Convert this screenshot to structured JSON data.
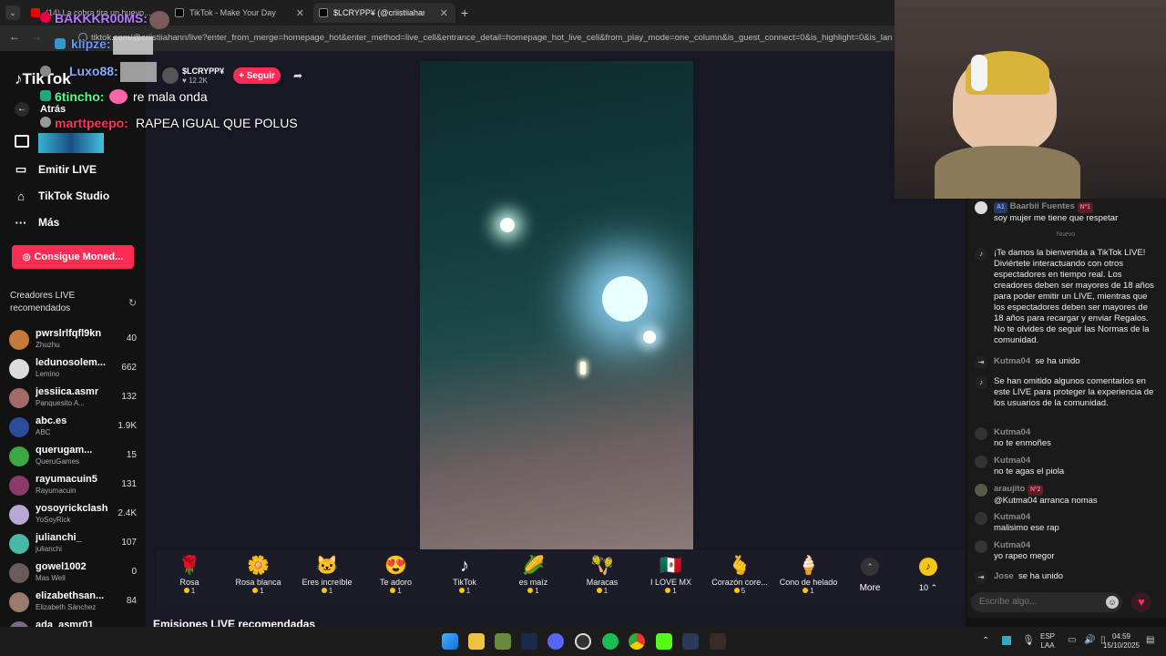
{
  "browser": {
    "tabs": [
      {
        "label": "(14) La cobra tira un huevo..."
      },
      {
        "label": "TikTok - Make Your Day"
      },
      {
        "label": "$LCRYPP¥ (@criistiiahann) ..."
      }
    ],
    "new_tab": "+",
    "url": "tiktok.com/@criistiiahann/live?enter_from_merge=homepage_hot&enter_method=live_cell&entrance_detail=homepage_hot_live_cell&from_play_mode=one_column&is_guest_connect=0&is_highlight=0&is_landsc"
  },
  "overlay_chat": [
    {
      "user": "BAKKKR00MS:",
      "text": ""
    },
    {
      "user": "klipze:",
      "text": ""
    },
    {
      "user": "Luxo88:",
      "text": ""
    },
    {
      "user": "6tincho:",
      "text": "re mala onda"
    },
    {
      "user": "marttpeepo:",
      "text": "RAPEA IGUAL QUE POLUS"
    }
  ],
  "sidebar": {
    "logo": "TikTok",
    "back": "Atrás",
    "items": [
      {
        "label": "Emitir LIVE",
        "icon": "camera-icon"
      },
      {
        "label": "TikTok Studio",
        "icon": "home-icon"
      },
      {
        "label": "Más",
        "icon": "more-icon"
      }
    ],
    "coins_button": "Consigue Moned...",
    "rec_title": "Creadores LIVE recomendados",
    "creators": [
      {
        "name": "pwrslrlfqfl9kn",
        "sub": "Zhuzhu",
        "count": "40",
        "color": "#c47a3a"
      },
      {
        "name": "ledunosolem...",
        "sub": "Lemino",
        "count": "662",
        "color": "#dcdcdc"
      },
      {
        "name": "jessiica.asmr",
        "sub": "Panquesito A...",
        "count": "132",
        "color": "#a46a6a"
      },
      {
        "name": "abc.es",
        "sub": "ABC",
        "count": "1.9K",
        "color": "#2a4c9a"
      },
      {
        "name": "querugam...",
        "sub": "QueruGames",
        "count": "15",
        "color": "#3aa845"
      },
      {
        "name": "rayumacuin5",
        "sub": "Rayumacuin",
        "count": "131",
        "color": "#8a3a6a"
      },
      {
        "name": "yosoyrickclash",
        "sub": "YoSoyRick",
        "count": "2.4K",
        "color": "#b8a8d8"
      },
      {
        "name": "julianchi_",
        "sub": "julianchi",
        "count": "107",
        "color": "#4ab8a8"
      },
      {
        "name": "gowel1002",
        "sub": "Mas Well",
        "count": "0",
        "color": "#6a5a5a"
      },
      {
        "name": "elizabethsan...",
        "sub": "Elizabeth Sánchez",
        "count": "84",
        "color": "#9a7a6a"
      },
      {
        "name": "ada_asmr01",
        "sub": "",
        "count": "",
        "color": "#7a6a8a"
      }
    ]
  },
  "host": {
    "name": "$LCRYPP¥",
    "likes": "12.2K",
    "follow": "+ Seguir"
  },
  "gifts": [
    {
      "name": "Rosa",
      "cost": "1",
      "icon": "🌹"
    },
    {
      "name": "Rosa blanca",
      "cost": "1",
      "icon": "🌼"
    },
    {
      "name": "Eres increíble",
      "cost": "1",
      "icon": "🐱"
    },
    {
      "name": "Te adoro",
      "cost": "1",
      "icon": "😍"
    },
    {
      "name": "TikTok",
      "cost": "1",
      "icon": "♪"
    },
    {
      "name": "es maíz",
      "cost": "1",
      "icon": "🌽"
    },
    {
      "name": "Maracas",
      "cost": "1",
      "icon": "🪇"
    },
    {
      "name": "I LOVE MX",
      "cost": "1",
      "icon": "🇲🇽"
    },
    {
      "name": "Corazón core...",
      "cost": "5",
      "icon": "🫰"
    },
    {
      "name": "Cono de helado",
      "cost": "1",
      "icon": "🍦"
    }
  ],
  "gifts_more": "More",
  "coin_balance": "10",
  "section_heading": "Emisiones LIVE recomendadas",
  "chat": {
    "messages": [
      {
        "user": "Baarbii Fuentes",
        "badge": "Nº1",
        "text": "soy mujer me tiene que respetar"
      },
      {
        "divider": "Nuevo"
      },
      {
        "system": "¡Te damos la bienvenida a TikTok LIVE! Diviértete interactuando con otros espectadores en tiempo real. Los creadores deben ser mayores de 18 años para poder emitir un LIVE, mientras que los espectadores deben ser mayores de 18 años para recargar y enviar Regalos. No te olvides de seguir las Normas de la comunidad."
      },
      {
        "join_user": "Kutma04",
        "join_text": "se ha unido"
      },
      {
        "system": "Se han omitido algunos comentarios en este LIVE para proteger la experiencia de los usuarios de la comunidad."
      },
      {
        "user": "Kutma04",
        "text": "no te enmoñes"
      },
      {
        "user": "Kutma04",
        "text": "no te agas el piola"
      },
      {
        "user": "araujito",
        "badge": "Nº2",
        "text": "@Kutma04 arranca nomas"
      },
      {
        "user": "Kutma04",
        "text": "malisimo ese rap"
      },
      {
        "user": "Kutma04",
        "text": "yo rapeo megor"
      },
      {
        "join_user": "Jose",
        "join_text": "se ha unido"
      }
    ],
    "input_placeholder": "Escribe algo..."
  },
  "taskbar": {
    "lang": "ESP",
    "lang2": "LAA",
    "time": "04:59",
    "date": "15/10/2025"
  }
}
